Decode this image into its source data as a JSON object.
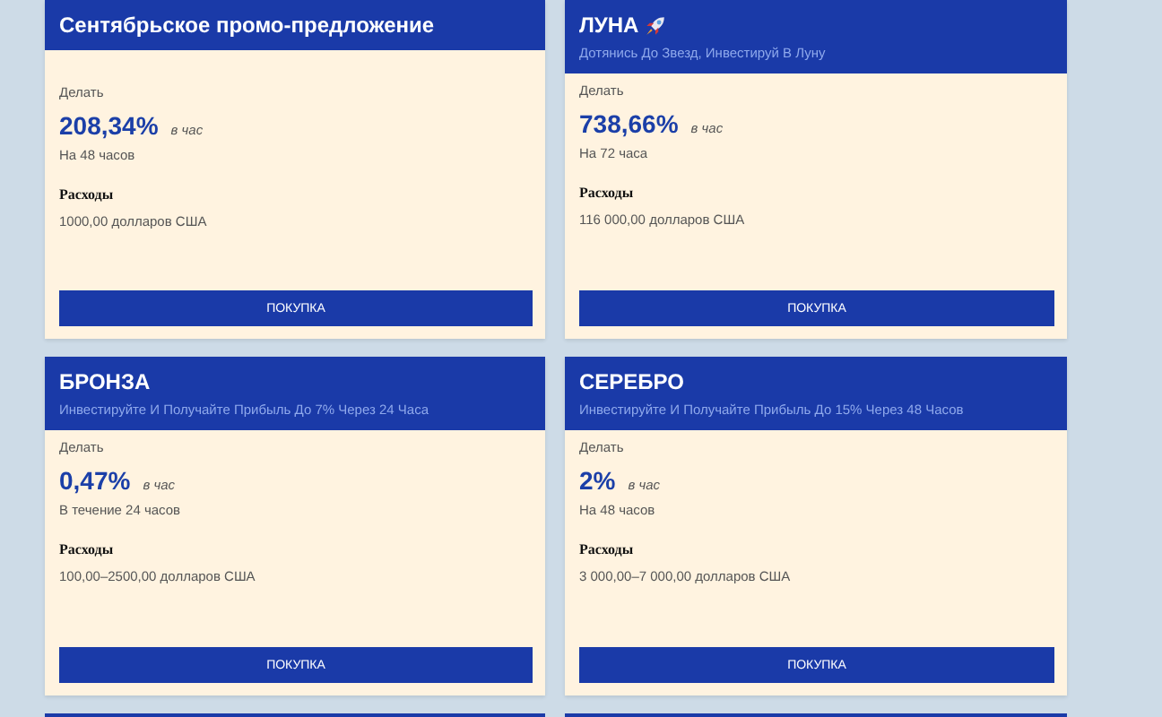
{
  "plans": [
    {
      "title": "Сентябрьское промо-предложение",
      "badge_icon": false,
      "make_label": "Делать",
      "rate": "208,34%",
      "rate_unit": "в час",
      "duration": "На 48 часов",
      "cost_label": "Расходы",
      "cost": "1000,00 долларов США",
      "button": "ПОКУПКА"
    },
    {
      "title": "ЛУНА",
      "badge_icon": true,
      "subtitle": "Дотянись До Звезд, Инвестируй В Луну",
      "make_label": "Делать",
      "rate": "738,66%",
      "rate_unit": "в час",
      "duration": "На 72 часа",
      "cost_label": "Расходы",
      "cost": "116 000,00 долларов США",
      "button": "ПОКУПКА"
    },
    {
      "title": "БРОНЗА",
      "badge_icon": false,
      "subtitle": "Инвестируйте И Получайте Прибыль До 7% Через 24 Часа",
      "make_label": "Делать",
      "rate": "0,47%",
      "rate_unit": "в час",
      "duration": "В течение 24 часов",
      "cost_label": "Расходы",
      "cost": "100,00–2500,00 долларов США",
      "button": "ПОКУПКА"
    },
    {
      "title": "СЕРЕБРО",
      "badge_icon": false,
      "subtitle": "Инвестируйте И Получайте Прибыль До 15% Через 48 Часов",
      "make_label": "Делать",
      "rate": "2%",
      "rate_unit": "в час",
      "duration": "На 48 часов",
      "cost_label": "Расходы",
      "cost": "3 000,00–7 000,00 долларов США",
      "button": "ПОКУПКА"
    }
  ]
}
